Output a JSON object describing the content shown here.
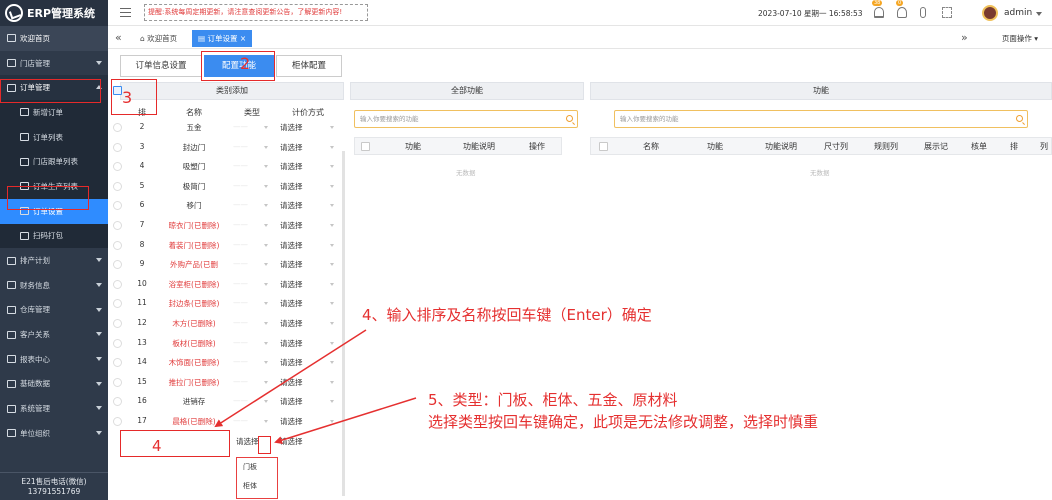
{
  "app": {
    "title": "ERP管理系统"
  },
  "sidebar": {
    "items": [
      {
        "label": "欢迎首页",
        "type": "home"
      },
      {
        "label": "门店管理",
        "type": "group"
      },
      {
        "label": "订单管理",
        "type": "open"
      },
      {
        "label": "新增订单",
        "type": "sub"
      },
      {
        "label": "订单列表",
        "type": "sub"
      },
      {
        "label": "门店跟单列表",
        "type": "sub"
      },
      {
        "label": "订单生产列表",
        "type": "sub"
      },
      {
        "label": "订单设置",
        "type": "sub-active"
      },
      {
        "label": "扫码打包",
        "type": "sub"
      },
      {
        "label": "排产计划",
        "type": "group"
      },
      {
        "label": "财务信息",
        "type": "group"
      },
      {
        "label": "仓库管理",
        "type": "group"
      },
      {
        "label": "客户关系",
        "type": "group"
      },
      {
        "label": "报表中心",
        "type": "group"
      },
      {
        "label": "基础数据",
        "type": "group"
      },
      {
        "label": "系统管理",
        "type": "group"
      },
      {
        "label": "单位组织",
        "type": "group"
      }
    ],
    "footer": {
      "line1": "E21售后电话(微信)",
      "line2": "13791551769"
    }
  },
  "topbar": {
    "notice": "提醒:系统每周定期更新，请注意查阅更新公告，了解更新内容!",
    "date": "2023-07-10",
    "weekday": "星期一",
    "time": "16:58:53",
    "badge1": "38",
    "badge2": "0",
    "user": "admin"
  },
  "tabs": {
    "home": "欢迎首页",
    "active": "订单设置",
    "close": "×",
    "page_ops": "页面操作"
  },
  "subtabs": [
    "订单信息设置",
    "配置功能",
    "柜体配置"
  ],
  "category_panel": {
    "title": "类别添加",
    "headers": {
      "sort": "排",
      "name": "名称",
      "type": "类型",
      "price": "计价方式"
    },
    "price_placeholder": "请选择",
    "rows": [
      {
        "sort": "2",
        "name": "五金",
        "deleted": false
      },
      {
        "sort": "3",
        "name": "封边门",
        "deleted": false
      },
      {
        "sort": "4",
        "name": "吸塑门",
        "deleted": false
      },
      {
        "sort": "5",
        "name": "极简门",
        "deleted": false
      },
      {
        "sort": "6",
        "name": "移门",
        "deleted": false
      },
      {
        "sort": "7",
        "name": "晾衣门(已删除)",
        "deleted": true
      },
      {
        "sort": "8",
        "name": "着装门(已删除)",
        "deleted": true
      },
      {
        "sort": "9",
        "name": "外购产品(已删",
        "deleted": true
      },
      {
        "sort": "10",
        "name": "浴室柜(已删除)",
        "deleted": true
      },
      {
        "sort": "11",
        "name": "封边条(已删除)",
        "deleted": true
      },
      {
        "sort": "12",
        "name": "木方(已删除)",
        "deleted": true
      },
      {
        "sort": "13",
        "name": "板材(已删除)",
        "deleted": true
      },
      {
        "sort": "14",
        "name": "木饰面(已删除)",
        "deleted": true
      },
      {
        "sort": "15",
        "name": "推拉门(已删除)",
        "deleted": true
      },
      {
        "sort": "16",
        "name": "进销存",
        "deleted": false
      },
      {
        "sort": "17",
        "name": "晨格(已删除)",
        "deleted": true
      }
    ],
    "new_row": {
      "type_placeholder": "请选择",
      "price_placeholder": "请选择"
    },
    "type_options": [
      "门板",
      "柜体"
    ]
  },
  "all_functions_panel": {
    "title": "全部功能",
    "search_placeholder": "输入你要搜索的功能",
    "headers": [
      "功能",
      "功能说明",
      "操作"
    ],
    "empty": "无数据"
  },
  "functions_panel": {
    "title": "功能",
    "search_placeholder": "输入你要搜索的功能",
    "headers": [
      "名称",
      "功能",
      "功能说明",
      "尺寸列",
      "规则列",
      "展示记",
      "核单",
      "排",
      "列"
    ],
    "empty": "无数据"
  },
  "annotations": {
    "n2": "2",
    "n3": "3",
    "n4": "4",
    "step4": "4、输入排序及名称按回车键（Enter）确定",
    "step5_line1": "5、类型：门板、柜体、五金、原材料",
    "step5_line2": "选择类型按回车键确定，此项是无法修改调整，选择时慎重"
  },
  "colors": {
    "sidebar": "#2f3a4a",
    "accent": "#3b8cf0",
    "annotation": "#e53030"
  }
}
